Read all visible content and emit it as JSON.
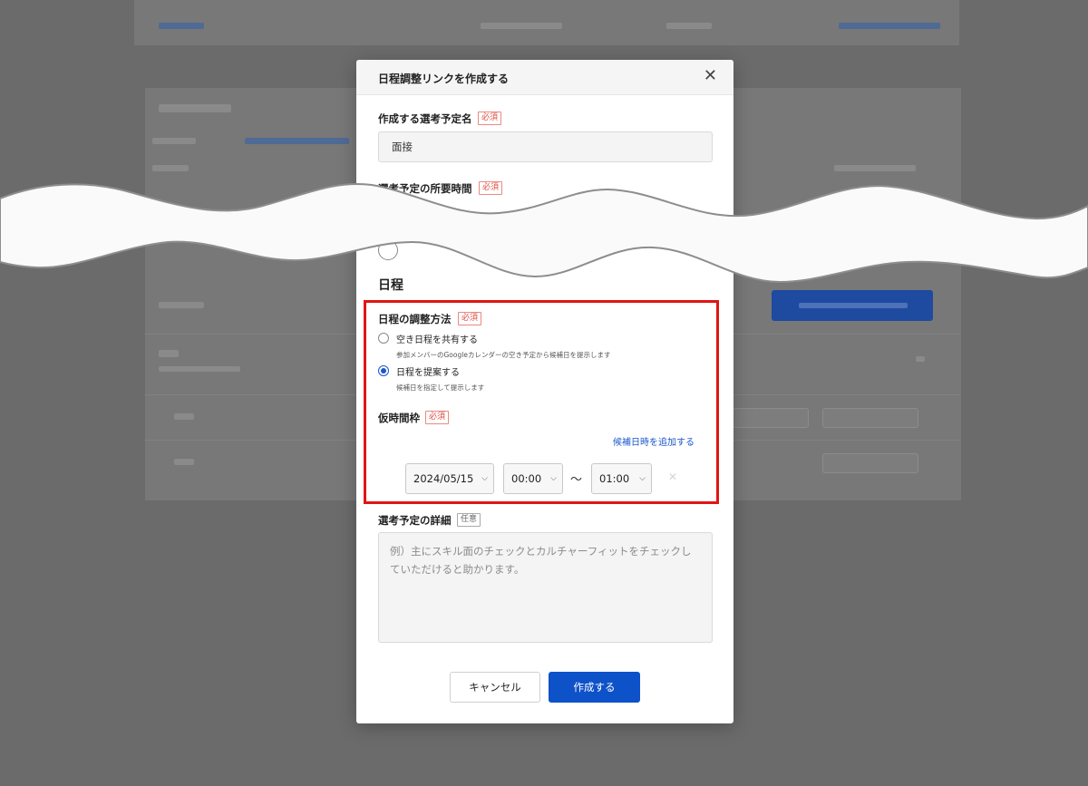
{
  "modal": {
    "title": "日程調整リンクを作成する",
    "close_icon": "close-icon",
    "name_field": {
      "label": "作成する選考予定名",
      "required_tag": "必須",
      "value": "面接"
    },
    "duration_field": {
      "label": "選考予定の所要時間",
      "required_tag": "必須"
    },
    "schedule_section_title": "日程",
    "adjust_method": {
      "label": "日程の調整方法",
      "required_tag": "必須",
      "options": [
        {
          "label": "空き日程を共有する",
          "help": "参加メンバーのGoogleカレンダーの空き予定から候補日を提示します",
          "selected": false
        },
        {
          "label": "日程を提案する",
          "help": "候補日を指定して提示します",
          "selected": true
        }
      ]
    },
    "tentative_slot": {
      "label": "仮時間枠",
      "required_tag": "必須",
      "add_link": "候補日時を追加する",
      "date": "2024/05/15",
      "start": "00:00",
      "separator": "〜",
      "end": "01:00"
    },
    "details": {
      "label": "選考予定の詳細",
      "optional_tag": "任意",
      "placeholder": "例）主にスキル面のチェックとカルチャーフィットをチェックしていただけると助かります。"
    },
    "buttons": {
      "cancel": "キャンセル",
      "create": "作成する"
    }
  },
  "colors": {
    "accent": "#0e52c9",
    "required": "#e04b3f",
    "highlight": "#e01515",
    "overlay": "#6b6b6b"
  }
}
